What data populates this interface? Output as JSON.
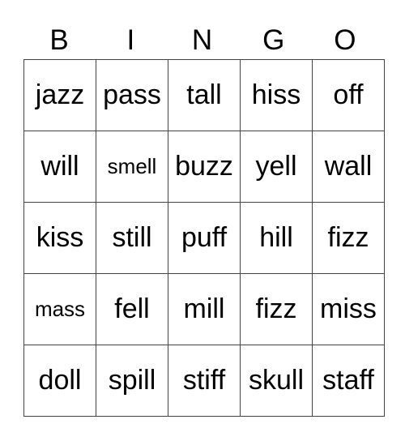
{
  "header": [
    "B",
    "I",
    "N",
    "G",
    "O"
  ],
  "cells": [
    [
      "jazz",
      "pass",
      "tall",
      "hiss",
      "off"
    ],
    [
      "will",
      "smell",
      "buzz",
      "yell",
      "wall"
    ],
    [
      "kiss",
      "still",
      "puff",
      "hill",
      "fizz"
    ],
    [
      "mass",
      "fell",
      "mill",
      "fizz",
      "miss"
    ],
    [
      "doll",
      "spill",
      "stiff",
      "skull",
      "staff"
    ]
  ]
}
